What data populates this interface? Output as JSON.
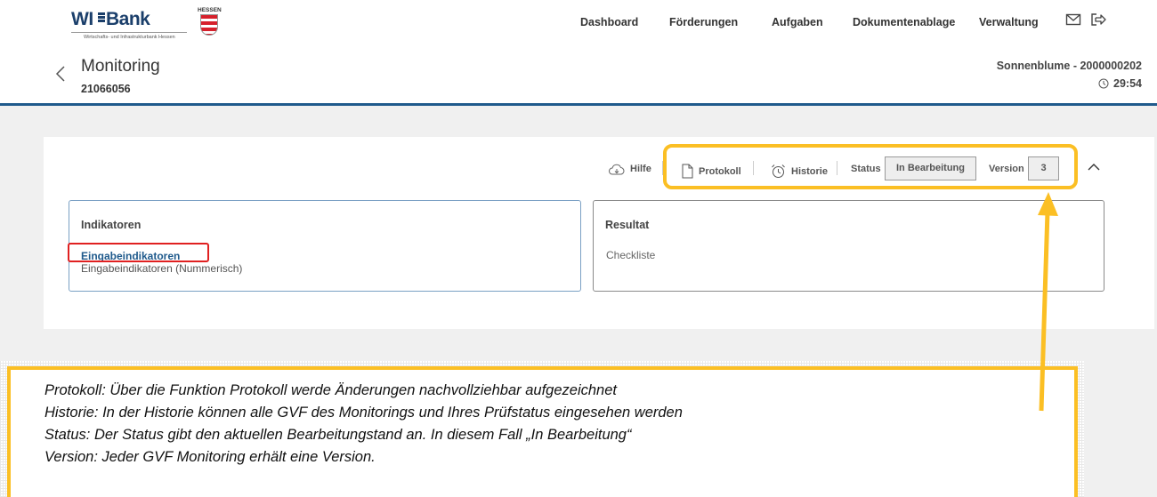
{
  "brand": {
    "name_part1": "WI",
    "name_part2": "Bank",
    "subtitle": "Wirtschafts- und Infrastrukturbank Hessen",
    "state_label": "HESSEN"
  },
  "nav": {
    "items": [
      "Dashboard",
      "Förderungen",
      "Aufgaben",
      "Dokumentenablage",
      "Verwaltung"
    ]
  },
  "header_icons": [
    "mail-icon",
    "logout-icon"
  ],
  "page": {
    "title": "Monitoring",
    "id": "21066056",
    "user_label": "Sonnenblume - 2000000202",
    "timer": "29:54"
  },
  "toolbar": {
    "help_label": "Hilfe",
    "protocol_label": "Protokoll",
    "history_label": "Historie",
    "status_label": "Status",
    "status_value": "In Bearbeitung",
    "version_label": "Version",
    "version_value": "3"
  },
  "panels": {
    "indicators": {
      "title": "Indikatoren",
      "link": "Eingabeindikatoren",
      "link_sub": "Eingabeindikatoren (Nummerisch)"
    },
    "result": {
      "title": "Resultat",
      "item": "Checkliste"
    }
  },
  "annotation": {
    "lines": [
      "Protokoll: Über die Funktion Protokoll werde Änderungen nachvollziehbar aufgezeichnet",
      "Historie: In der Historie können alle GVF des Monitorings und Ihres Prüfstatus eingesehen werden",
      "Status:   Der Status gibt den aktuellen Bearbeitungstand an. In diesem Fall „In Bearbeitung“",
      "Version: Jeder GVF Monitoring erhält eine Version."
    ]
  },
  "colors": {
    "brand_blue": "#1f5a8c",
    "highlight_yellow": "#fbbf24",
    "highlight_red": "#e02020"
  }
}
